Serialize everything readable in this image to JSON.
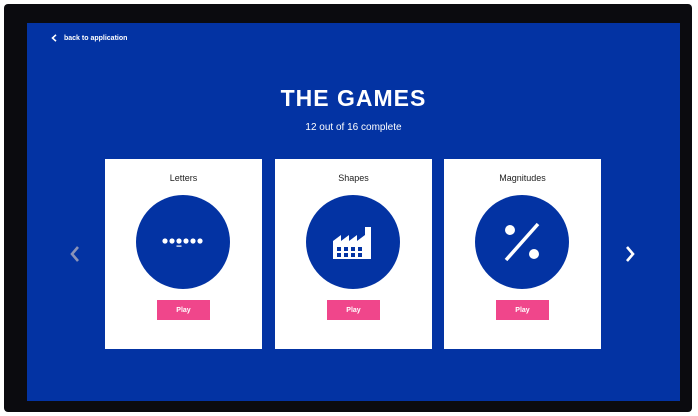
{
  "nav": {
    "back_label": "back to application"
  },
  "header": {
    "title": "THE GAMES",
    "progress": "12 out of 16 complete"
  },
  "games": [
    {
      "title": "Letters",
      "icon": "dots-icon",
      "play_label": "Play"
    },
    {
      "title": "Shapes",
      "icon": "factory-icon",
      "play_label": "Play"
    },
    {
      "title": "Magnitudes",
      "icon": "percent-icon",
      "play_label": "Play"
    }
  ],
  "carousel": {
    "prev_icon": "chevron-left-icon",
    "next_icon": "chevron-right-icon"
  },
  "colors": {
    "panel": "#0333a3",
    "frame": "#0b0b0f",
    "play_button": "#f0468b",
    "card": "#ffffff"
  }
}
